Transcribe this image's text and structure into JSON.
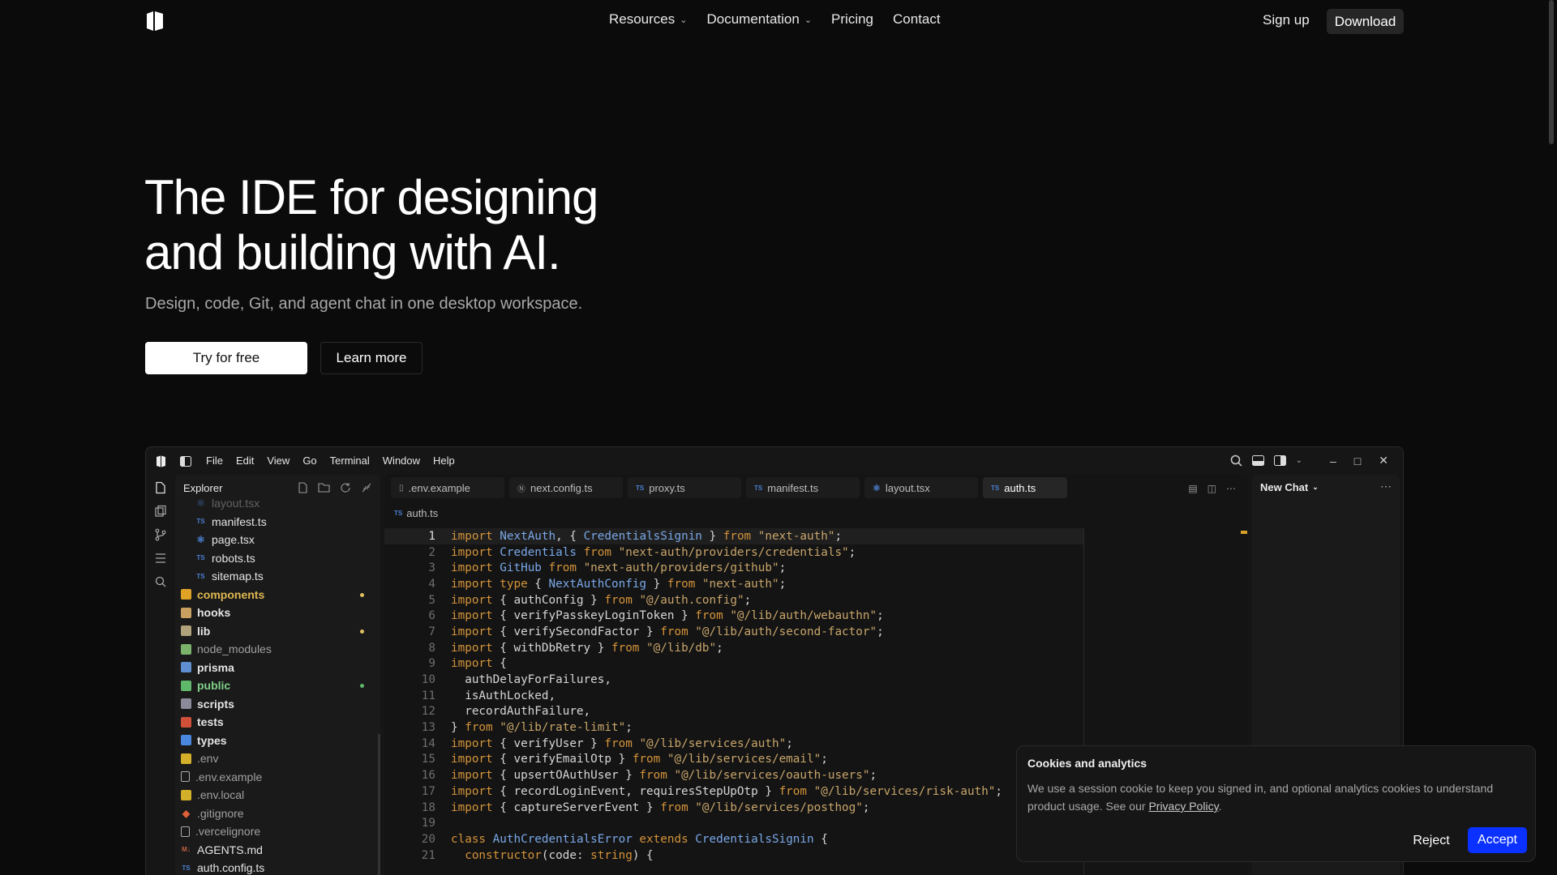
{
  "nav": {
    "items": [
      {
        "label": "Resources",
        "has_dropdown": true
      },
      {
        "label": "Documentation",
        "has_dropdown": true
      },
      {
        "label": "Pricing",
        "has_dropdown": false
      },
      {
        "label": "Contact",
        "has_dropdown": false
      }
    ],
    "signup": "Sign up",
    "download": "Download"
  },
  "hero": {
    "title_line1": "The IDE for designing",
    "title_line2": "and building with AI.",
    "subtitle": "Design, code, Git, and agent chat in one desktop workspace.",
    "primary_cta": "Try for free",
    "secondary_cta": "Learn more"
  },
  "ide": {
    "menu": [
      "File",
      "Edit",
      "View",
      "Go",
      "Terminal",
      "Window",
      "Help"
    ],
    "explorer_title": "Explorer",
    "tree": [
      {
        "name": "layout.tsx",
        "kind": "react",
        "indent": 1,
        "faded": true
      },
      {
        "name": "manifest.ts",
        "kind": "ts",
        "indent": 1
      },
      {
        "name": "page.tsx",
        "kind": "react",
        "indent": 1
      },
      {
        "name": "robots.ts",
        "kind": "ts",
        "indent": 1
      },
      {
        "name": "sitemap.ts",
        "kind": "ts",
        "indent": 1
      },
      {
        "name": "components",
        "kind": "folder",
        "indent": 0,
        "color": "#e0a326",
        "dot": "#e0c060"
      },
      {
        "name": "hooks",
        "kind": "folder",
        "indent": 0,
        "color": "#caa060"
      },
      {
        "name": "lib",
        "kind": "folder",
        "indent": 0,
        "color": "#b0a27a",
        "dot": "#e0c060"
      },
      {
        "name": "node_modules",
        "kind": "folder",
        "indent": 0,
        "color": "#7bb36a",
        "muted": true
      },
      {
        "name": "prisma",
        "kind": "folder",
        "indent": 0,
        "color": "#5f8fd0"
      },
      {
        "name": "public",
        "kind": "folder",
        "indent": 0,
        "color": "#5fb86a",
        "text_color": "#7fd08a",
        "dot": "#5fb86a"
      },
      {
        "name": "scripts",
        "kind": "folder",
        "indent": 0,
        "color": "#8a8a9a"
      },
      {
        "name": "tests",
        "kind": "folder",
        "indent": 0,
        "color": "#d0503a"
      },
      {
        "name": "types",
        "kind": "folder",
        "indent": 0,
        "color": "#4a88e0"
      },
      {
        "name": ".env",
        "kind": "env",
        "indent": 0,
        "muted": true
      },
      {
        "name": ".env.example",
        "kind": "file",
        "indent": 0,
        "muted": true
      },
      {
        "name": ".env.local",
        "kind": "env",
        "indent": 0,
        "muted": true
      },
      {
        "name": ".gitignore",
        "kind": "git",
        "indent": 0,
        "muted": true
      },
      {
        "name": ".vercelignore",
        "kind": "file",
        "indent": 0,
        "muted": true
      },
      {
        "name": "AGENTS.md",
        "kind": "md",
        "indent": 0
      },
      {
        "name": "auth.config.ts",
        "kind": "ts",
        "indent": 0
      }
    ],
    "tabs": [
      {
        "label": ".env.example",
        "kind": "file",
        "active": false
      },
      {
        "label": "next.config.ts",
        "kind": "next",
        "active": false
      },
      {
        "label": "proxy.ts",
        "kind": "ts",
        "active": false
      },
      {
        "label": "manifest.ts",
        "kind": "ts",
        "active": false
      },
      {
        "label": "layout.tsx",
        "kind": "react",
        "active": false
      },
      {
        "label": "auth.ts",
        "kind": "ts",
        "active": true
      }
    ],
    "breadcrumb": "auth.ts",
    "code_lines": [
      "import NextAuth, { CredentialsSignin } from \"next-auth\";",
      "import Credentials from \"next-auth/providers/credentials\";",
      "import GitHub from \"next-auth/providers/github\";",
      "import type { NextAuthConfig } from \"next-auth\";",
      "import { authConfig } from \"@/auth.config\";",
      "import { verifyPasskeyLoginToken } from \"@/lib/auth/webauthn\";",
      "import { verifySecondFactor } from \"@/lib/auth/second-factor\";",
      "import { withDbRetry } from \"@/lib/db\";",
      "import {",
      "  authDelayForFailures,",
      "  isAuthLocked,",
      "  recordAuthFailure,",
      "} from \"@/lib/rate-limit\";",
      "import { verifyUser } from \"@/lib/services/auth\";",
      "import { verifyEmailOtp } from \"@/lib/services/email\";",
      "import { upsertOAuthUser } from \"@/lib/services/oauth-users\";",
      "import { recordLoginEvent, requiresStepUpOtp } from \"@/lib/services/risk-auth\";",
      "import { captureServerEvent } from \"@/lib/services/posthog\";",
      "",
      "class AuthCredentialsError extends CredentialsSignin {",
      "  constructor(code: string) {"
    ],
    "chat_title": "New Chat"
  },
  "cookie": {
    "title": "Cookies and analytics",
    "text_before": "We use a session cookie to keep you signed in, and optional analytics cookies to understand product usage. See our ",
    "link": "Privacy Policy",
    "text_after": ".",
    "reject": "Reject",
    "accept": "Accept"
  }
}
